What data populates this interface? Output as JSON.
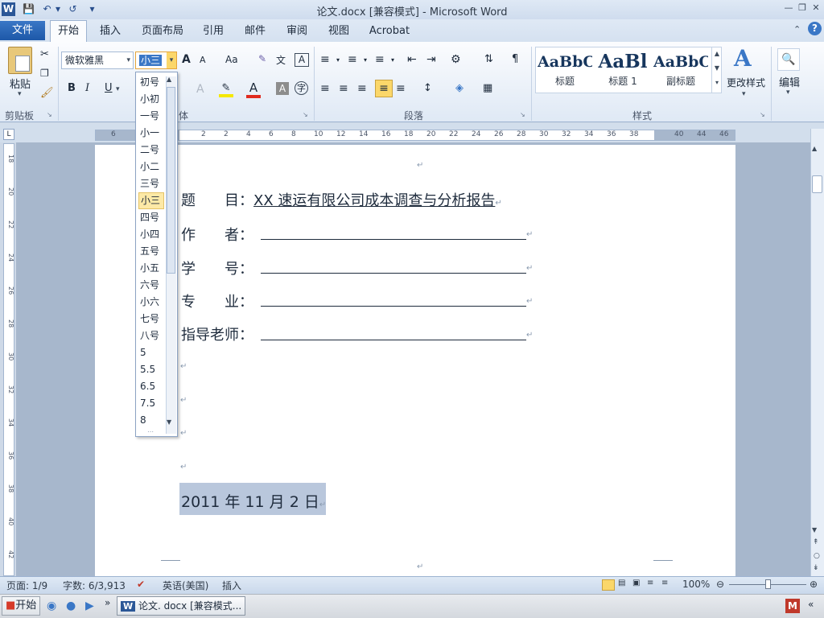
{
  "window": {
    "title": "论文.docx [兼容模式] - Microsoft Word",
    "app_icon": "W"
  },
  "quick_access": [
    "save-icon",
    "undo-icon",
    "redo-icon",
    "customize-icon"
  ],
  "tabs": {
    "file": "文件",
    "items": [
      "开始",
      "插入",
      "页面布局",
      "引用",
      "邮件",
      "审阅",
      "视图",
      "Acrobat"
    ],
    "active": "开始"
  },
  "ribbon": {
    "clipboard": {
      "paste": "粘贴",
      "group": "剪贴板"
    },
    "font": {
      "name": "微软雅黑",
      "size": "小三",
      "group": "体",
      "grow": "A",
      "shrink": "A",
      "case": "Aa",
      "bold": "B",
      "italic": "I",
      "underline": "U"
    },
    "paragraph": {
      "group": "段落"
    },
    "styles": {
      "group": "样式",
      "items": [
        {
          "sample": "AaBbC",
          "label": "标题"
        },
        {
          "sample": "AaBl",
          "label": "标题 1"
        },
        {
          "sample": "AaBbC",
          "label": "副标题"
        }
      ],
      "change": "更改样式"
    },
    "editing": {
      "label": "编辑"
    }
  },
  "font_size_dropdown": {
    "options": [
      "初号",
      "小初",
      "一号",
      "小一",
      "二号",
      "小二",
      "三号",
      "小三",
      "四号",
      "小四",
      "五号",
      "小五",
      "六号",
      "小六",
      "七号",
      "八号",
      "5",
      "5.5",
      "6.5",
      "7.5",
      "8"
    ],
    "selected": "小三"
  },
  "ruler": {
    "ticks": [
      "6",
      "4",
      "2",
      "2",
      "4",
      "6",
      "8",
      "10",
      "12",
      "14",
      "16",
      "18",
      "20",
      "22",
      "24",
      "26",
      "28",
      "30",
      "32",
      "34",
      "36",
      "38",
      "40",
      "44",
      "46",
      "48"
    ],
    "vticks": [
      "18",
      "20",
      "22",
      "24",
      "26",
      "28",
      "30",
      "32",
      "34",
      "36",
      "38",
      "40",
      "42"
    ]
  },
  "document": {
    "rows": [
      {
        "label": "题　　目：",
        "value": "XX 速运有限公司成本调查与分析报告"
      },
      {
        "label": "作　　者：",
        "value": ""
      },
      {
        "label": "学　　号：",
        "value": ""
      },
      {
        "label": "专　　业：",
        "value": ""
      },
      {
        "label": "指导老师：",
        "value": ""
      }
    ],
    "date": "2011 年 11 月 2 日",
    "para_mark": "↵"
  },
  "status_bar": {
    "page": "页面: 1/9",
    "words": "字数: 6/3,913",
    "language": "英语(美国)",
    "mode": "插入",
    "zoom": "100%"
  },
  "taskbar": {
    "start": "开始",
    "window": "论文. docx [兼容模式..."
  }
}
